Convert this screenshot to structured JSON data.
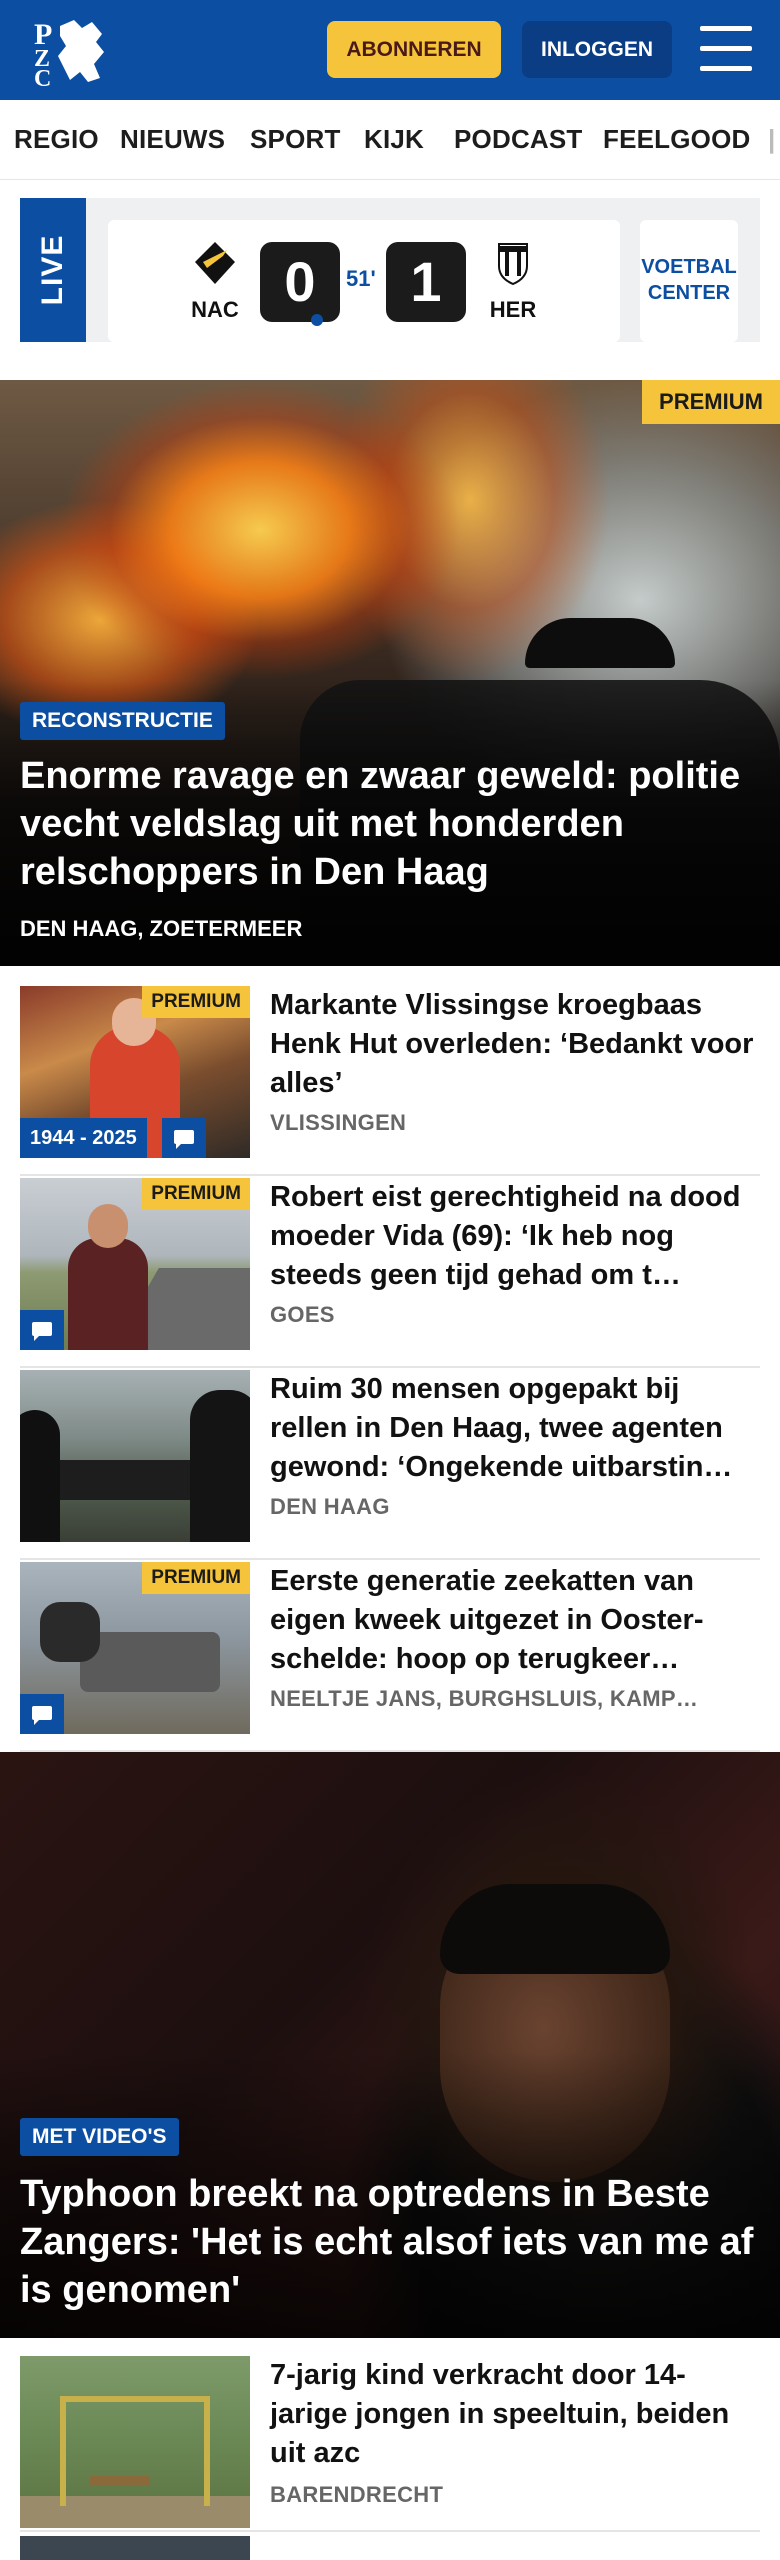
{
  "header": {
    "logo_text": "PZC",
    "subscribe_label": "ABONNEREN",
    "login_label": "INLOGGEN",
    "brand_color": "#0b4ea2",
    "accent_color": "#f5c43b"
  },
  "nav": {
    "items": [
      {
        "label": "REGIO"
      },
      {
        "label": "NIEUWS"
      },
      {
        "label": "SPORT"
      },
      {
        "label": "KIJK"
      },
      {
        "label": "PODCAST"
      },
      {
        "label": "FEELGOOD"
      }
    ]
  },
  "live": {
    "tag": "LIVE",
    "home_team": "NAC",
    "home_score": "0",
    "minute": "51'",
    "away_score": "1",
    "away_team": "HER",
    "voetbal_center": "VOETBAL CENTER"
  },
  "hero": {
    "premium": "PREMIUM",
    "badge": "RECONSTRUCTIE",
    "title": "Enorme ravage en zwaar geweld: politie vecht veldslag uit met honderden relschoppers in Den Haag",
    "location": "DEN HAAG, ZOETERMEER"
  },
  "articles": [
    {
      "premium": "PREMIUM",
      "years": "1944 - 2025",
      "title": "Markante Vlissingse kroegbaas Henk Hut overleden: ‘Bedankt voor alles’",
      "location": "VLISSINGEN"
    },
    {
      "premium": "PREMIUM",
      "title": "Robert eist gerechtigheid na dood moeder Vida (69): ‘Ik heb nog steeds geen tijd gehad om t…",
      "location": "GOES"
    },
    {
      "title": "Ruim 30 mensen opgepakt bij rellen in Den Haag, twee agenten gewond: ‘Ongekende uitbarstin…",
      "location": "DEN HAAG"
    },
    {
      "premium": "PREMIUM",
      "title": "Eerste generatie zeekatten van eigen kweek uitgezet in Ooster-schelde: hoop op terugkeer…",
      "location": "NEELTJE JANS, BURGHSLUIS, KAMP…"
    }
  ],
  "video_hero": {
    "badge": "MET VIDEO'S",
    "title": "Typhoon breekt na optredens in Beste Zangers: 'Het is echt alsof iets van me af is genomen'"
  },
  "article_after_video": {
    "title": "7-jarig kind verkracht door 14-jarige jongen in speeltuin, beiden uit azc",
    "location": "BARENDRECHT"
  }
}
